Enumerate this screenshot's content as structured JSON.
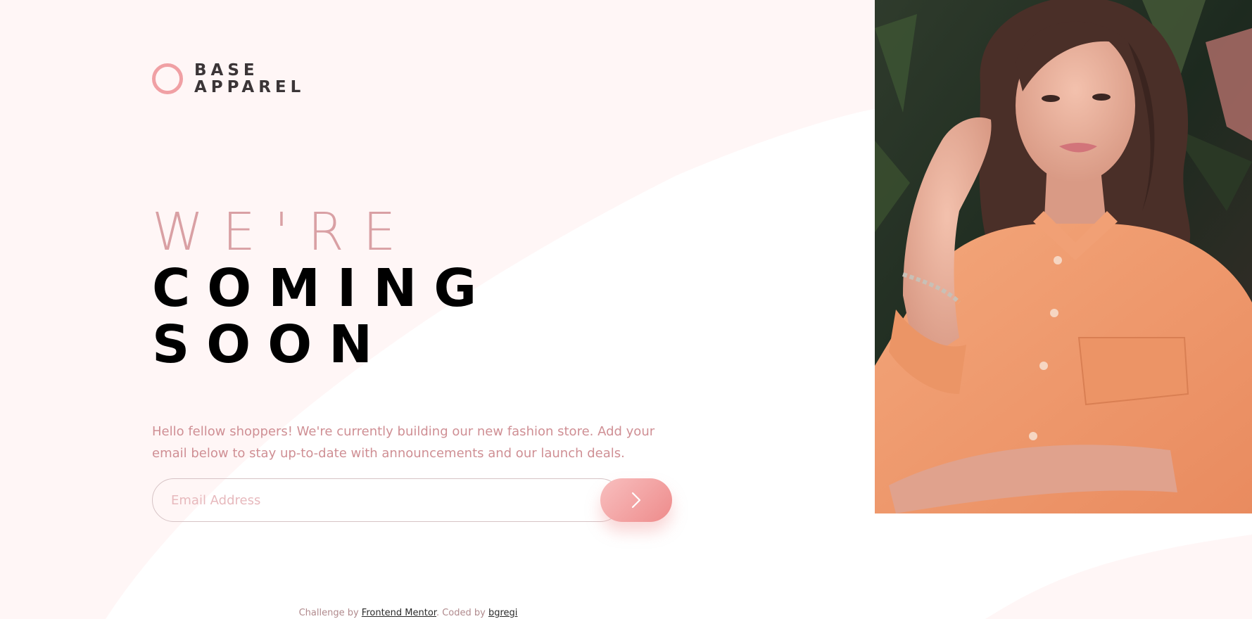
{
  "brand": {
    "name_line1": "BASE",
    "name_line2": "APPAREL"
  },
  "headline": {
    "line1": "WE'RE",
    "line2": "COMING",
    "line3": "SOON"
  },
  "description": "Hello fellow shoppers! We're currently building our new fashion store. Add your email below to stay up-to-date with announcements and our launch deals.",
  "form": {
    "email_placeholder": "Email Address",
    "email_value": "",
    "submit_icon": "chevron-right-icon"
  },
  "hero_image": {
    "subject": "woman in orange shirt"
  },
  "footer": {
    "challenge_prefix": "Challenge by",
    "challenge_link": "Frontend Mentor",
    "coded_prefix": ". Coded by",
    "coded_link": "bgregi"
  },
  "colors": {
    "accent": "#f0a0a4",
    "accent_text": "#cf8f94",
    "heading_dark": "#000000",
    "background_tint": "#fff6f6"
  }
}
